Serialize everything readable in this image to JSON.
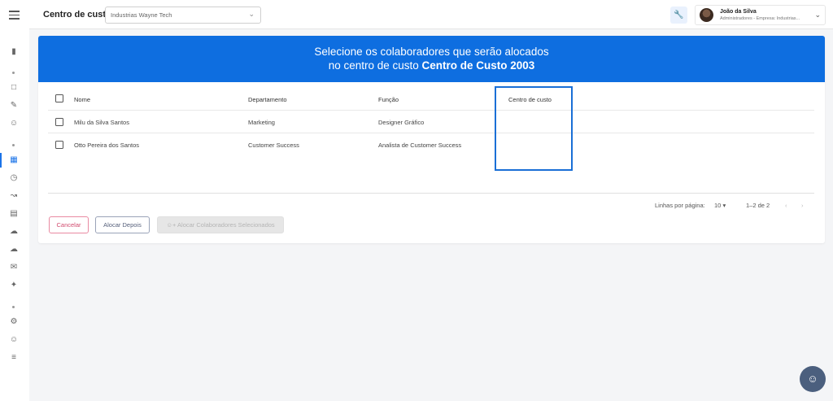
{
  "topbar": {
    "title": "Centro de custo",
    "company_select_value": "Industrias Wayne Tech",
    "user_name": "João da Silva",
    "user_role": "Administradores - Empresa: Industrias..."
  },
  "banner": {
    "line1": "Selecione os colaboradores que serão alocados",
    "line2_prefix": "no centro de custo ",
    "cost_center_name": "Centro de Custo 2003"
  },
  "table": {
    "headers": {
      "nome": "Nome",
      "departamento": "Departamento",
      "funcao": "Função",
      "centro": "Centro de custo"
    },
    "rows": [
      {
        "nome": "Milu da Silva Santos",
        "departamento": "Marketing",
        "funcao": "Designer Gráfico",
        "centro": ""
      },
      {
        "nome": "Otto Pereira dos Santos",
        "departamento": "Customer Success",
        "funcao": "Analista de Customer Success",
        "centro": ""
      }
    ]
  },
  "pagination": {
    "rows_per_page_label": "Linhas por página:",
    "rows_per_page": "10",
    "range": "1–2 de 2"
  },
  "actions": {
    "cancel": "Cancelar",
    "allocate_later": "Alocar Depois",
    "allocate_selected": "Alocar Colaboradores Selecionados"
  },
  "icons": {
    "menu": "menu-icon",
    "wrench": "wrench-icon",
    "support": "support-icon"
  },
  "colors": {
    "primary": "#0e6ee0",
    "cancel": "#d14a6e",
    "highlight": "#1a6fd6"
  }
}
